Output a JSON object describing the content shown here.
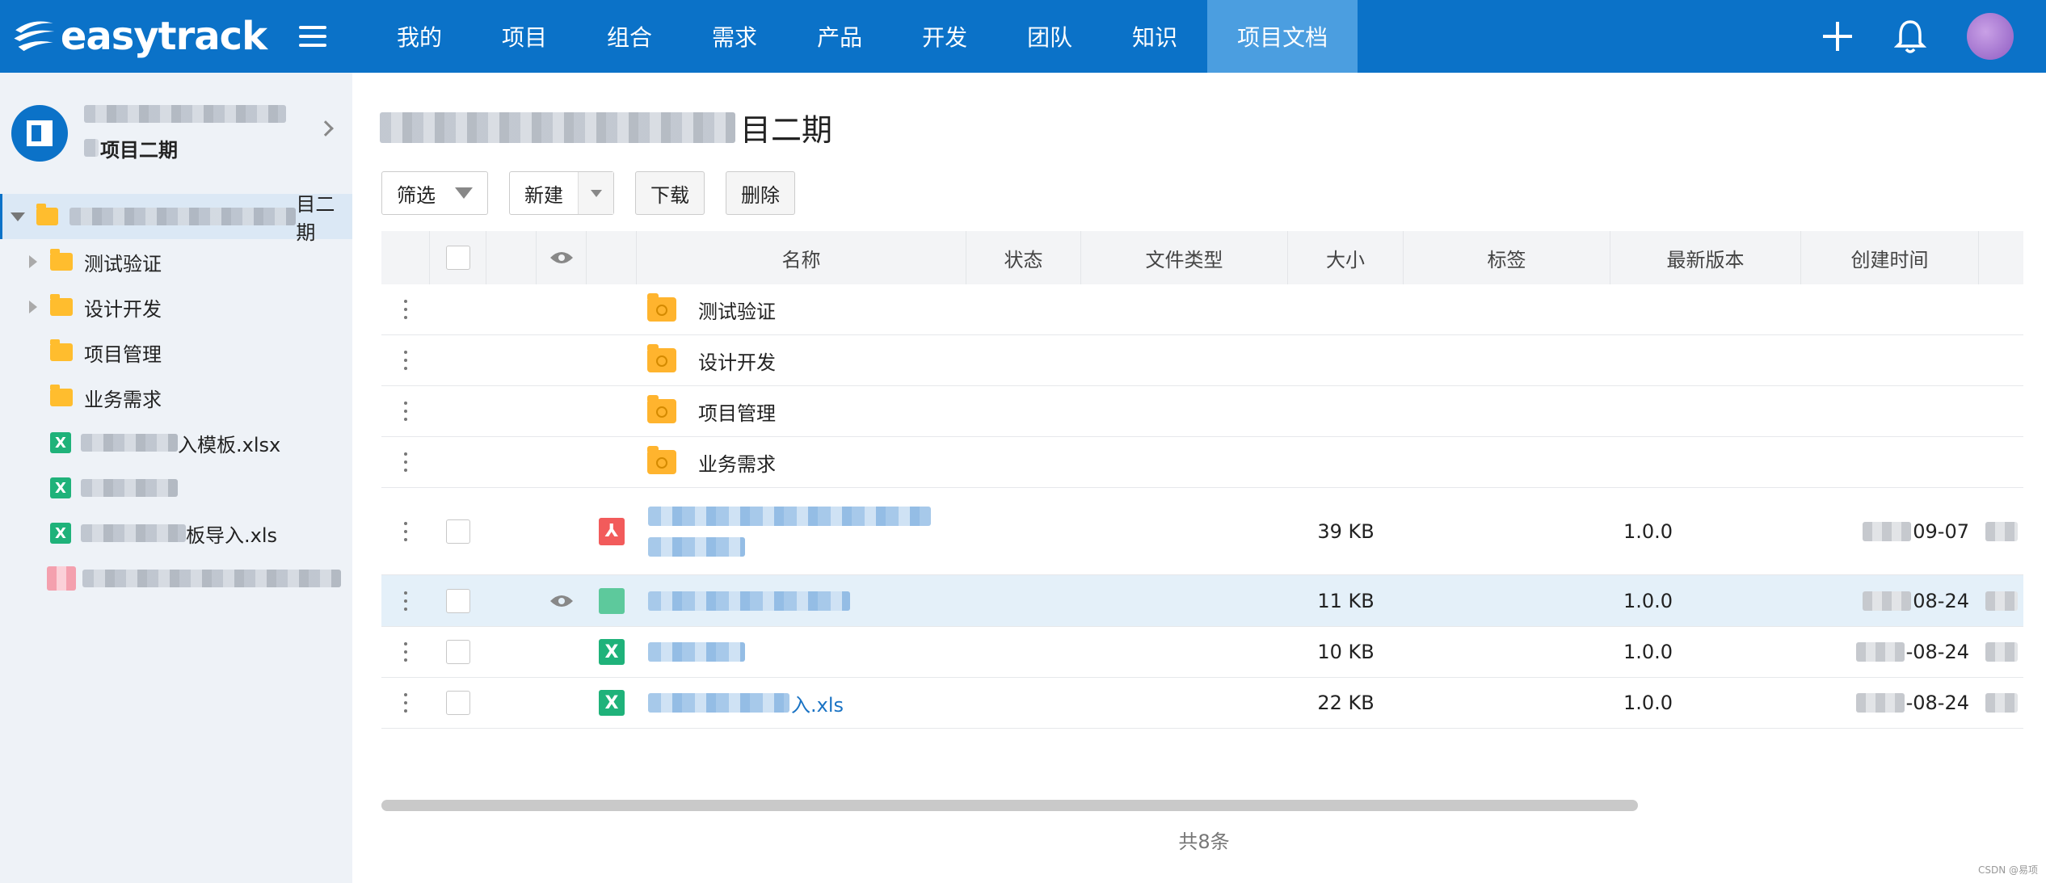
{
  "header": {
    "logo_text": "easytrack",
    "nav": [
      "我的",
      "项目",
      "组合",
      "需求",
      "产品",
      "开发",
      "团队",
      "知识",
      "项目文档"
    ],
    "active_nav": "项目文档",
    "colors": {
      "bar": "#0b72c8",
      "active": "#4b9ee0"
    }
  },
  "sidebar": {
    "project_subtitle": "项目二期",
    "tree_root_suffix": "目二期",
    "tree": [
      {
        "label": "测试验证",
        "type": "folder",
        "expandable": true
      },
      {
        "label": "设计开发",
        "type": "folder",
        "expandable": true
      },
      {
        "label": "项目管理",
        "type": "folder",
        "expandable": false
      },
      {
        "label": "业务需求",
        "type": "folder",
        "expandable": false
      },
      {
        "label": "入模板.xlsx",
        "type": "xls"
      },
      {
        "label": "",
        "type": "xls"
      },
      {
        "label": "板导入.xls",
        "type": "xls"
      }
    ]
  },
  "main": {
    "title_suffix": "目二期",
    "toolbar": {
      "filter": "筛选",
      "new": "新建",
      "download": "下载",
      "delete": "删除"
    },
    "columns": [
      "名称",
      "状态",
      "文件类型",
      "大小",
      "标签",
      "最新版本",
      "创建时间"
    ],
    "rows": [
      {
        "name": "测试验证",
        "icon": "folder"
      },
      {
        "name": "设计开发",
        "icon": "folder"
      },
      {
        "name": "项目管理",
        "icon": "folder"
      },
      {
        "name": "业务需求",
        "icon": "folder"
      },
      {
        "name": "",
        "icon": "pdf",
        "size": "39 KB",
        "version": "1.0.0",
        "created": "09-07"
      },
      {
        "name": "",
        "icon": "xls",
        "size": "11 KB",
        "version": "1.0.0",
        "created": "08-24",
        "highlight": true
      },
      {
        "name": "",
        "icon": "xls",
        "size": "10 KB",
        "version": "1.0.0",
        "created": "-08-24"
      },
      {
        "name": "入.xls",
        "icon": "xls",
        "size": "22 KB",
        "version": "1.0.0",
        "created": "-08-24"
      }
    ],
    "total": "共8条"
  },
  "watermark": "CSDN @易项"
}
